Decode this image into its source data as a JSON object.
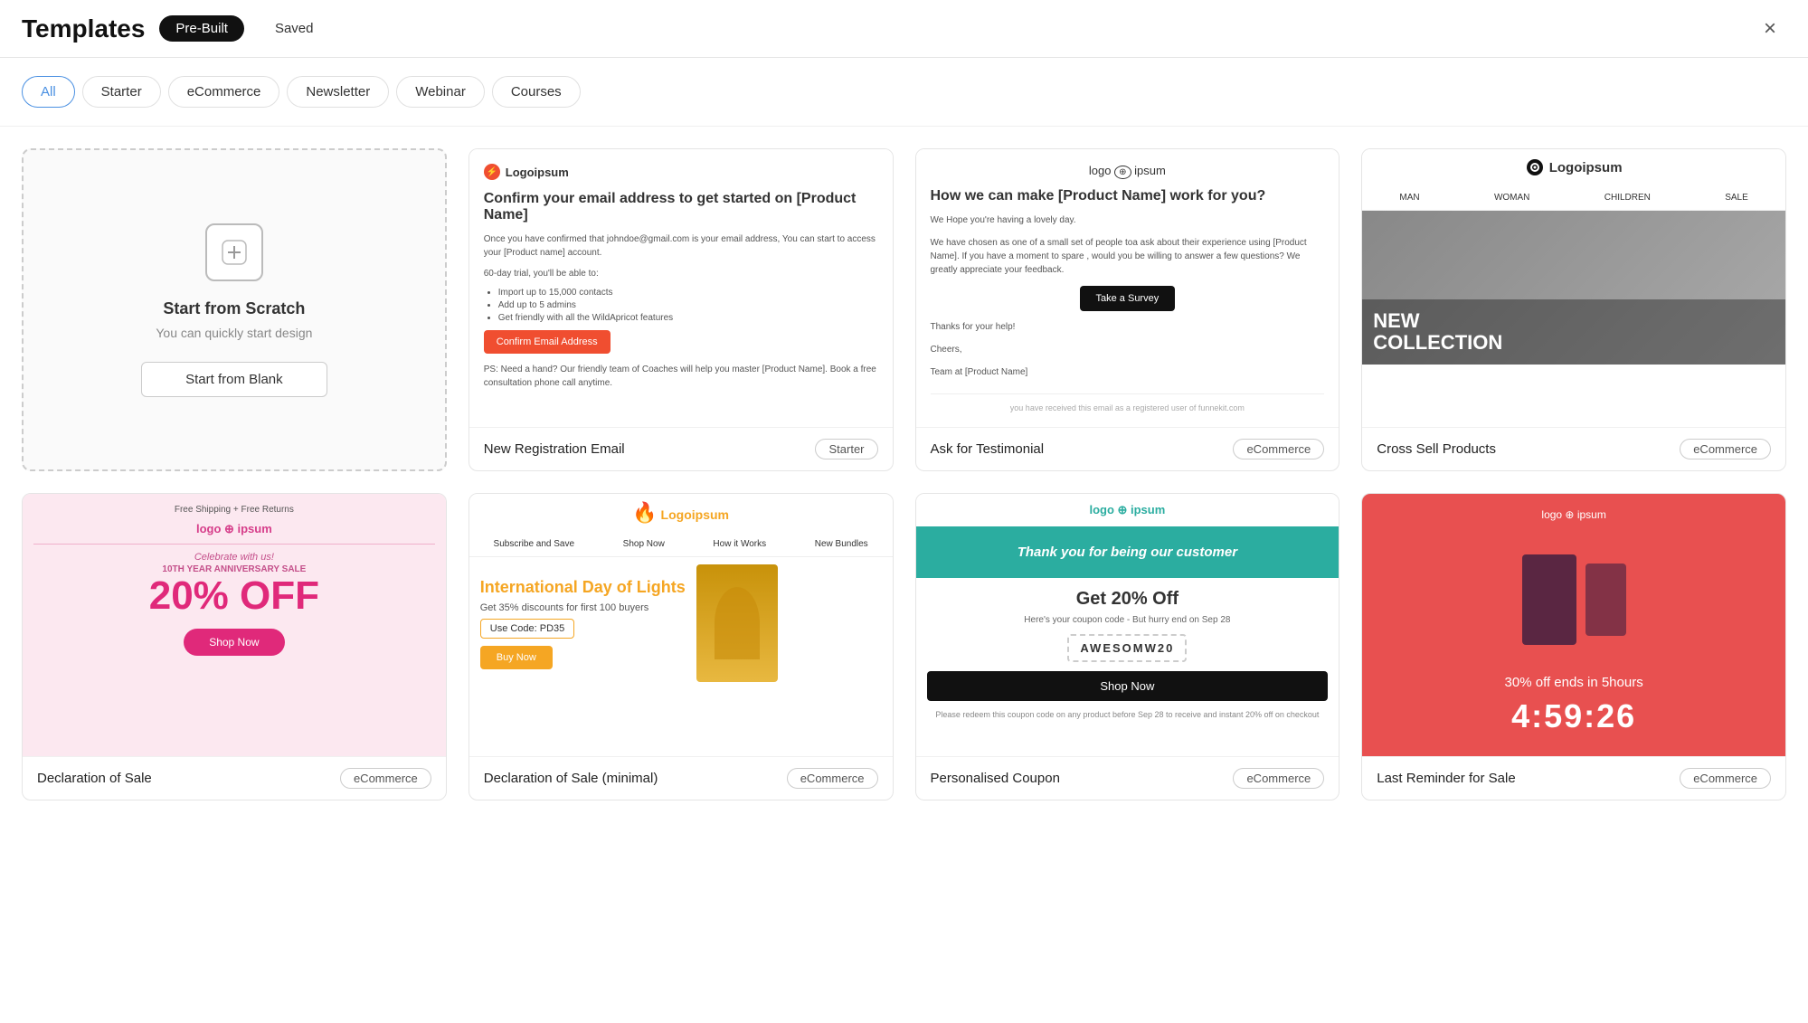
{
  "header": {
    "title": "Templates",
    "tab_prebuilt": "Pre-Built",
    "tab_saved": "Saved",
    "close_label": "×"
  },
  "filter_tabs": [
    {
      "label": "All",
      "active": true
    },
    {
      "label": "Starter",
      "active": false
    },
    {
      "label": "eCommerce",
      "active": false
    },
    {
      "label": "Newsletter",
      "active": false
    },
    {
      "label": "Webinar",
      "active": false
    },
    {
      "label": "Courses",
      "active": false
    }
  ],
  "scratch_card": {
    "icon": "+",
    "title": "Start from Scratch",
    "subtitle": "You can quickly start design",
    "button": "Start from Blank"
  },
  "templates": [
    {
      "name": "new-registration-email",
      "title": "New Registration Email",
      "badge": "Starter",
      "type": "registration"
    },
    {
      "name": "ask-for-testimonial",
      "title": "Ask for Testimonial",
      "badge": "eCommerce",
      "type": "testimonial"
    },
    {
      "name": "cross-sell-products",
      "title": "Cross Sell Products",
      "badge": "eCommerce",
      "type": "crosssell"
    },
    {
      "name": "declaration-of-sale",
      "title": "Declaration of Sale",
      "badge": "eCommerce",
      "type": "sale"
    },
    {
      "name": "declaration-of-sale-minimal",
      "title": "Declaration of Sale (minimal)",
      "badge": "eCommerce",
      "type": "saleminimal"
    },
    {
      "name": "personalised-coupon",
      "title": "Personalised Coupon",
      "badge": "eCommerce",
      "type": "coupon"
    },
    {
      "name": "last-reminder-for-sale",
      "title": "Last Reminder for Sale",
      "badge": "eCommerce",
      "type": "reminder"
    }
  ],
  "preview_texts": {
    "logoipsum": "Logoipsum",
    "logoipsum_alt": "logo ⊕ ipsum",
    "reg_heading": "Confirm your email address to get started on [Product Name]",
    "reg_p1": "Once you have confirmed that johndoe@gmail.com is your email address, You can start to access your [Product name] account.",
    "reg_trial": "60-day trial, you'll be able to:",
    "reg_list": [
      "Import up to 15,000 contacts",
      "Add up to 5 admins",
      "Get friendly with all the WildApricot features"
    ],
    "reg_confirm_btn": "Confirm Email Address",
    "reg_ps": "PS: Need a hand? Our friendly team of Coaches will help you master [Product Name]. Book a free consultation phone call anytime.",
    "testi_heading": "How we can make [Product Name] work for you?",
    "testi_p1": "We Hope you're having a lovely day.",
    "testi_p2": "We have chosen as one of a small set of people toa ask about their experience using [Product Name]. If you have a moment to spare , would you be willing to answer a few questions? We greatly appreciate your feedback.",
    "testi_btn": "Take a Survey",
    "testi_thanks": "Thanks for your help!",
    "testi_cheers": "Cheers,",
    "testi_team": "Team at [Product Name]",
    "testi_footer": "you have received this email as a registered user of funnekit.com",
    "cross_nav": [
      "MAN",
      "WOMAN",
      "CHILDREN",
      "SALE"
    ],
    "cross_hero": "NEW\nCOLLECTION",
    "sale_free_ship": "Free Shipping + Free Returns",
    "sale_celebrate": "Celebrate with us!",
    "sale_year": "10TH YEAR ANNIVERSARY SALE",
    "sale_off": "20% OFF",
    "sale_btn": "Shop Now",
    "min_nav": [
      "Subscribe and Save",
      "Shop Now",
      "How it Works",
      "New Bundles"
    ],
    "min_heading": "International Day of Lights",
    "min_sub": "Get 35% discounts for first 100 buyers",
    "min_code": "Use Code: PD35",
    "min_btn": "Buy Now",
    "coupon_hero": "Thank you for being our customer",
    "coupon_h3": "Get 20% Off",
    "coupon_p": "Here's your coupon code - But hurry end on Sep 28",
    "coupon_code": "AWESOMW20",
    "coupon_btn": "Shop Now",
    "coupon_footer": "Please redeem this coupon code on any product before Sep 28 to receive and instant 20% off on checkout",
    "rem_logo": "logo ⊕ ipsum",
    "rem_off": "30% off ends in 5hours",
    "rem_timer": "4:59:26"
  }
}
